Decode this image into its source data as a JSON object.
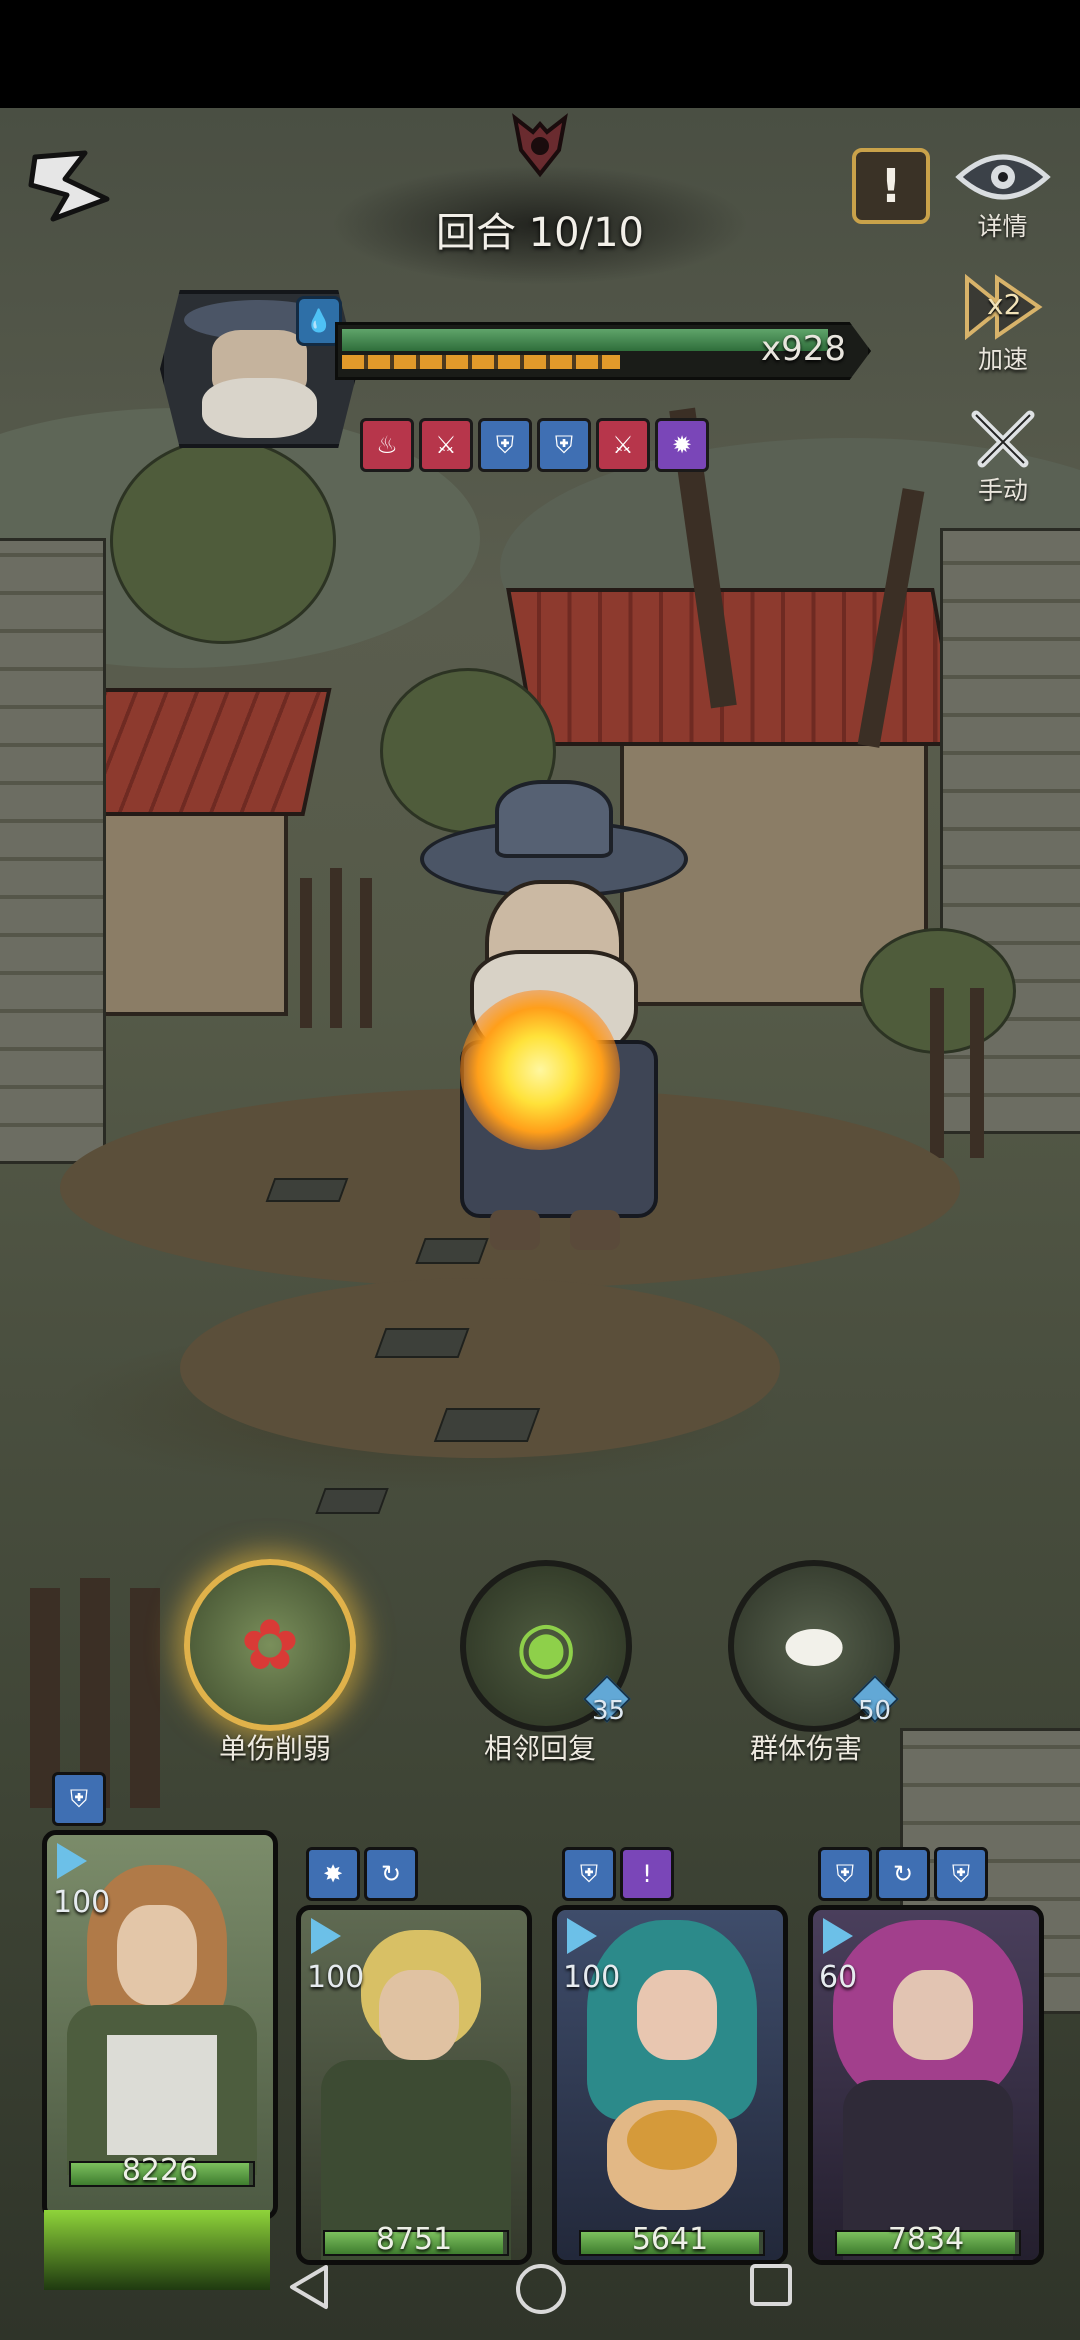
{
  "header": {
    "round_text": "回合 10/10",
    "details_label": "详情",
    "speed_label": "加速",
    "speed_badge": "x2",
    "manual_label": "手动",
    "alert_symbol": "!"
  },
  "boss": {
    "multiplier": "x928",
    "hp_fraction": 0.96,
    "shield_fraction": 0.55,
    "element_icon": "water-drop-icon",
    "buffs": [
      {
        "icon": "fire-down-icon",
        "color": "#b7364b"
      },
      {
        "icon": "attack-down-icon",
        "color": "#b7364b"
      },
      {
        "icon": "defense-up-icon",
        "color": "#3f6fb3"
      },
      {
        "icon": "defense-up-icon",
        "color": "#3f6fb3"
      },
      {
        "icon": "attack-down-icon",
        "color": "#b7364b"
      },
      {
        "icon": "burst-icon",
        "color": "#7a46b8"
      }
    ]
  },
  "skills": [
    {
      "label": "单伤削弱",
      "cost": "",
      "icon": "rose-wind-icon"
    },
    {
      "label": "相邻回复",
      "cost": "35",
      "icon": "potion-icon"
    },
    {
      "label": "群体伤害",
      "cost": "50",
      "icon": "egg-swirl-icon"
    }
  ],
  "heroes": [
    {
      "name": "maid",
      "energy": "100",
      "hp": "8226",
      "hp_fraction": 0.98,
      "statuses": [
        "shield-buff-icon"
      ]
    },
    {
      "name": "ranger",
      "energy": "100",
      "hp": "8751",
      "hp_fraction": 0.98,
      "statuses": [
        "crit-buff-icon",
        "cycle-buff-icon"
      ]
    },
    {
      "name": "siren",
      "energy": "100",
      "hp": "5641",
      "hp_fraction": 0.98,
      "statuses": [
        "shield-buff-icon",
        "alert-icon"
      ]
    },
    {
      "name": "witch",
      "energy": "60",
      "hp": "7834",
      "hp_fraction": 0.98,
      "statuses": [
        "shield-buff-icon",
        "cycle-buff-icon",
        "defense-up-icon"
      ]
    }
  ],
  "colors": {
    "hp_green": "#5fa46a",
    "energy_blue": "#6cc0e8",
    "alert_gold": "#c9a24a"
  }
}
